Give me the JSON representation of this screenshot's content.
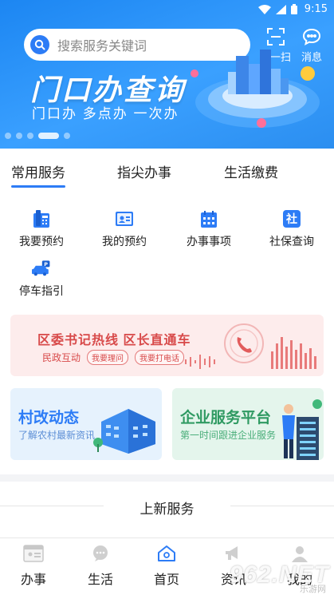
{
  "status": {
    "time": "9:15"
  },
  "search": {
    "placeholder": "搜索服务关键词"
  },
  "actions": {
    "scan": "扫一扫",
    "messages": "消息"
  },
  "banner": {
    "title": "门口办查询",
    "subtitle": "门口办 多点办 一次办",
    "slides": 5,
    "active_slide": 3
  },
  "tabs": [
    {
      "label": "常用服务",
      "active": true
    },
    {
      "label": "指尖办事",
      "active": false
    },
    {
      "label": "生活缴费",
      "active": false
    }
  ],
  "services": [
    {
      "label": "我要预约",
      "icon": "phone-icon"
    },
    {
      "label": "我的预约",
      "icon": "id-card-icon"
    },
    {
      "label": "办事事项",
      "icon": "calendar-icon"
    },
    {
      "label": "社保查询",
      "icon": "social-security-icon"
    },
    {
      "label": "停车指引",
      "icon": "parking-car-icon"
    }
  ],
  "hotline": {
    "title": "区委书记热线  区长直通车",
    "tag": "民政互动",
    "pills": [
      "我要理问",
      "我要打电话"
    ]
  },
  "cards": [
    {
      "title": "村改动态",
      "subtitle": "了解农村最新资讯"
    },
    {
      "title": "企业服务平台",
      "subtitle": "第一时间跟进企业服务"
    }
  ],
  "new_services": {
    "title": "上新服务"
  },
  "nav": [
    {
      "label": "办事",
      "icon": "window-icon",
      "active": false
    },
    {
      "label": "生活",
      "icon": "chat-bubble-icon",
      "active": false
    },
    {
      "label": "首页",
      "icon": "home-icon",
      "active": true
    },
    {
      "label": "资讯",
      "icon": "megaphone-icon",
      "active": false
    },
    {
      "label": "我的",
      "icon": "user-icon",
      "active": false
    }
  ],
  "watermark": {
    "text": "962.NET",
    "sub": "乐游网"
  },
  "colors": {
    "primary": "#2d7cf6",
    "banner": "#2b8ef0",
    "hotline_red": "#d84a4a",
    "card_blue": "#e6f2fd",
    "card_green": "#e4f5ec"
  }
}
